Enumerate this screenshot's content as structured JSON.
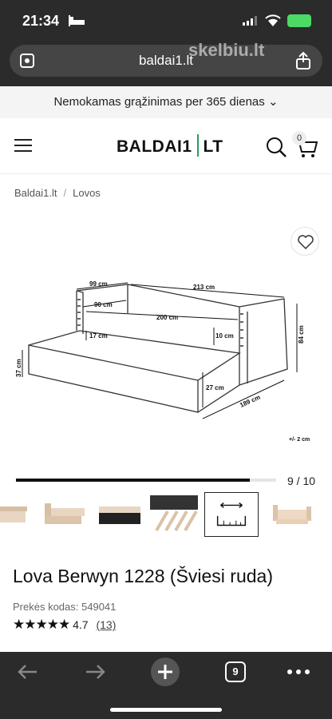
{
  "status": {
    "time": "21:34"
  },
  "browser": {
    "url": "baldai1.lt",
    "watermark": "skelbiu.lt",
    "tab_count": "9"
  },
  "promo": {
    "text": "Nemokamas grąžinimas per 365 dienas"
  },
  "header": {
    "logo_left": "BALDAI1",
    "logo_right": "LT",
    "cart_count": "0"
  },
  "breadcrumb": {
    "home": "Baldai1.lt",
    "category": "Lovos"
  },
  "gallery": {
    "counter": "9 / 10",
    "progress": 0.9,
    "dimensions": {
      "d99": "99 cm",
      "d213": "213 cm",
      "d90": "90 cm",
      "d200": "200 cm",
      "d17": "17 cm",
      "d10": "10 cm",
      "d84": "84 cm",
      "d37": "37 cm",
      "d27": "27 cm",
      "d189": "189 cm",
      "tolerance": "+/- 2 cm"
    }
  },
  "product": {
    "title": "Lova Berwyn 1228 (Šviesi ruda)",
    "code_label": "Prekės kodas:",
    "code": "549041",
    "stars": "★★★★★",
    "rating": "4.7",
    "reviews": "(13)"
  },
  "colors": {
    "accent": "#2a9d5c",
    "dark_bar": "#2b2b2b"
  }
}
